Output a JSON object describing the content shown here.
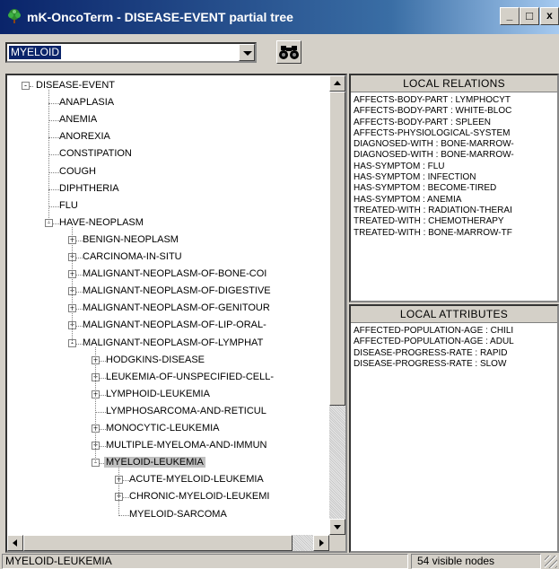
{
  "window": {
    "title": "mK-OncoTerm - DISEASE-EVENT partial tree",
    "buttons": {
      "minimize": "_",
      "maximize": "□",
      "close": "x"
    }
  },
  "toolbar": {
    "search_value": "MYELOID"
  },
  "tree": {
    "nodes": [
      {
        "label": "DISEASE-EVENT",
        "level": 0,
        "toggle": "-"
      },
      {
        "label": "ANAPLASIA",
        "level": 1,
        "toggle": ""
      },
      {
        "label": "ANEMIA",
        "level": 1,
        "toggle": ""
      },
      {
        "label": "ANOREXIA",
        "level": 1,
        "toggle": ""
      },
      {
        "label": "CONSTIPATION",
        "level": 1,
        "toggle": ""
      },
      {
        "label": "COUGH",
        "level": 1,
        "toggle": ""
      },
      {
        "label": "DIPHTHERIA",
        "level": 1,
        "toggle": ""
      },
      {
        "label": "FLU",
        "level": 1,
        "toggle": ""
      },
      {
        "label": "HAVE-NEOPLASM",
        "level": 1,
        "toggle": "-"
      },
      {
        "label": "BENIGN-NEOPLASM",
        "level": 2,
        "toggle": "+"
      },
      {
        "label": "CARCINOMA-IN-SITU",
        "level": 2,
        "toggle": "+"
      },
      {
        "label": "MALIGNANT-NEOPLASM-OF-BONE-COI",
        "level": 2,
        "toggle": "+"
      },
      {
        "label": "MALIGNANT-NEOPLASM-OF-DIGESTIVE",
        "level": 2,
        "toggle": "+"
      },
      {
        "label": "MALIGNANT-NEOPLASM-OF-GENITOUR",
        "level": 2,
        "toggle": "+"
      },
      {
        "label": "MALIGNANT-NEOPLASM-OF-LIP-ORAL-",
        "level": 2,
        "toggle": "+"
      },
      {
        "label": "MALIGNANT-NEOPLASM-OF-LYMPHAT",
        "level": 2,
        "toggle": "-"
      },
      {
        "label": "HODGKINS-DISEASE",
        "level": 3,
        "toggle": "+"
      },
      {
        "label": "LEUKEMIA-OF-UNSPECIFIED-CELL-",
        "level": 3,
        "toggle": "+"
      },
      {
        "label": "LYMPHOID-LEUKEMIA",
        "level": 3,
        "toggle": "+"
      },
      {
        "label": "LYMPHOSARCOMA-AND-RETICUL",
        "level": 3,
        "toggle": ""
      },
      {
        "label": "MONOCYTIC-LEUKEMIA",
        "level": 3,
        "toggle": "+"
      },
      {
        "label": "MULTIPLE-MYELOMA-AND-IMMUN",
        "level": 3,
        "toggle": "+"
      },
      {
        "label": "MYELOID-LEUKEMIA",
        "level": 3,
        "toggle": "-",
        "selected": true
      },
      {
        "label": "ACUTE-MYELOID-LEUKEMIA",
        "level": 4,
        "toggle": "+"
      },
      {
        "label": "CHRONIC-MYELOID-LEUKEMI",
        "level": 4,
        "toggle": "+"
      },
      {
        "label": "MYELOID-SARCOMA",
        "level": 4,
        "toggle": ""
      }
    ]
  },
  "relations": {
    "header": "LOCAL RELATIONS",
    "items": [
      "AFFECTS-BODY-PART : LYMPHOCYT",
      "AFFECTS-BODY-PART : WHITE-BLOC",
      "AFFECTS-BODY-PART : SPLEEN",
      "AFFECTS-PHYSIOLOGICAL-SYSTEM",
      "DIAGNOSED-WITH : BONE-MARROW-",
      "DIAGNOSED-WITH : BONE-MARROW-",
      "HAS-SYMPTOM : FLU",
      "HAS-SYMPTOM : INFECTION",
      "HAS-SYMPTOM : BECOME-TIRED",
      "HAS-SYMPTOM : ANEMIA",
      "TREATED-WITH : RADIATION-THERAI",
      "TREATED-WITH : CHEMOTHERAPY",
      "TREATED-WITH : BONE-MARROW-TF"
    ]
  },
  "attributes": {
    "header": "LOCAL ATTRIBUTES",
    "items": [
      "AFFECTED-POPULATION-AGE : CHILI",
      "AFFECTED-POPULATION-AGE : ADUL",
      "DISEASE-PROGRESS-RATE : RAPID",
      "DISEASE-PROGRESS-RATE : SLOW"
    ]
  },
  "status": {
    "selected": "MYELOID-LEUKEMIA",
    "count": "54 visible nodes"
  }
}
